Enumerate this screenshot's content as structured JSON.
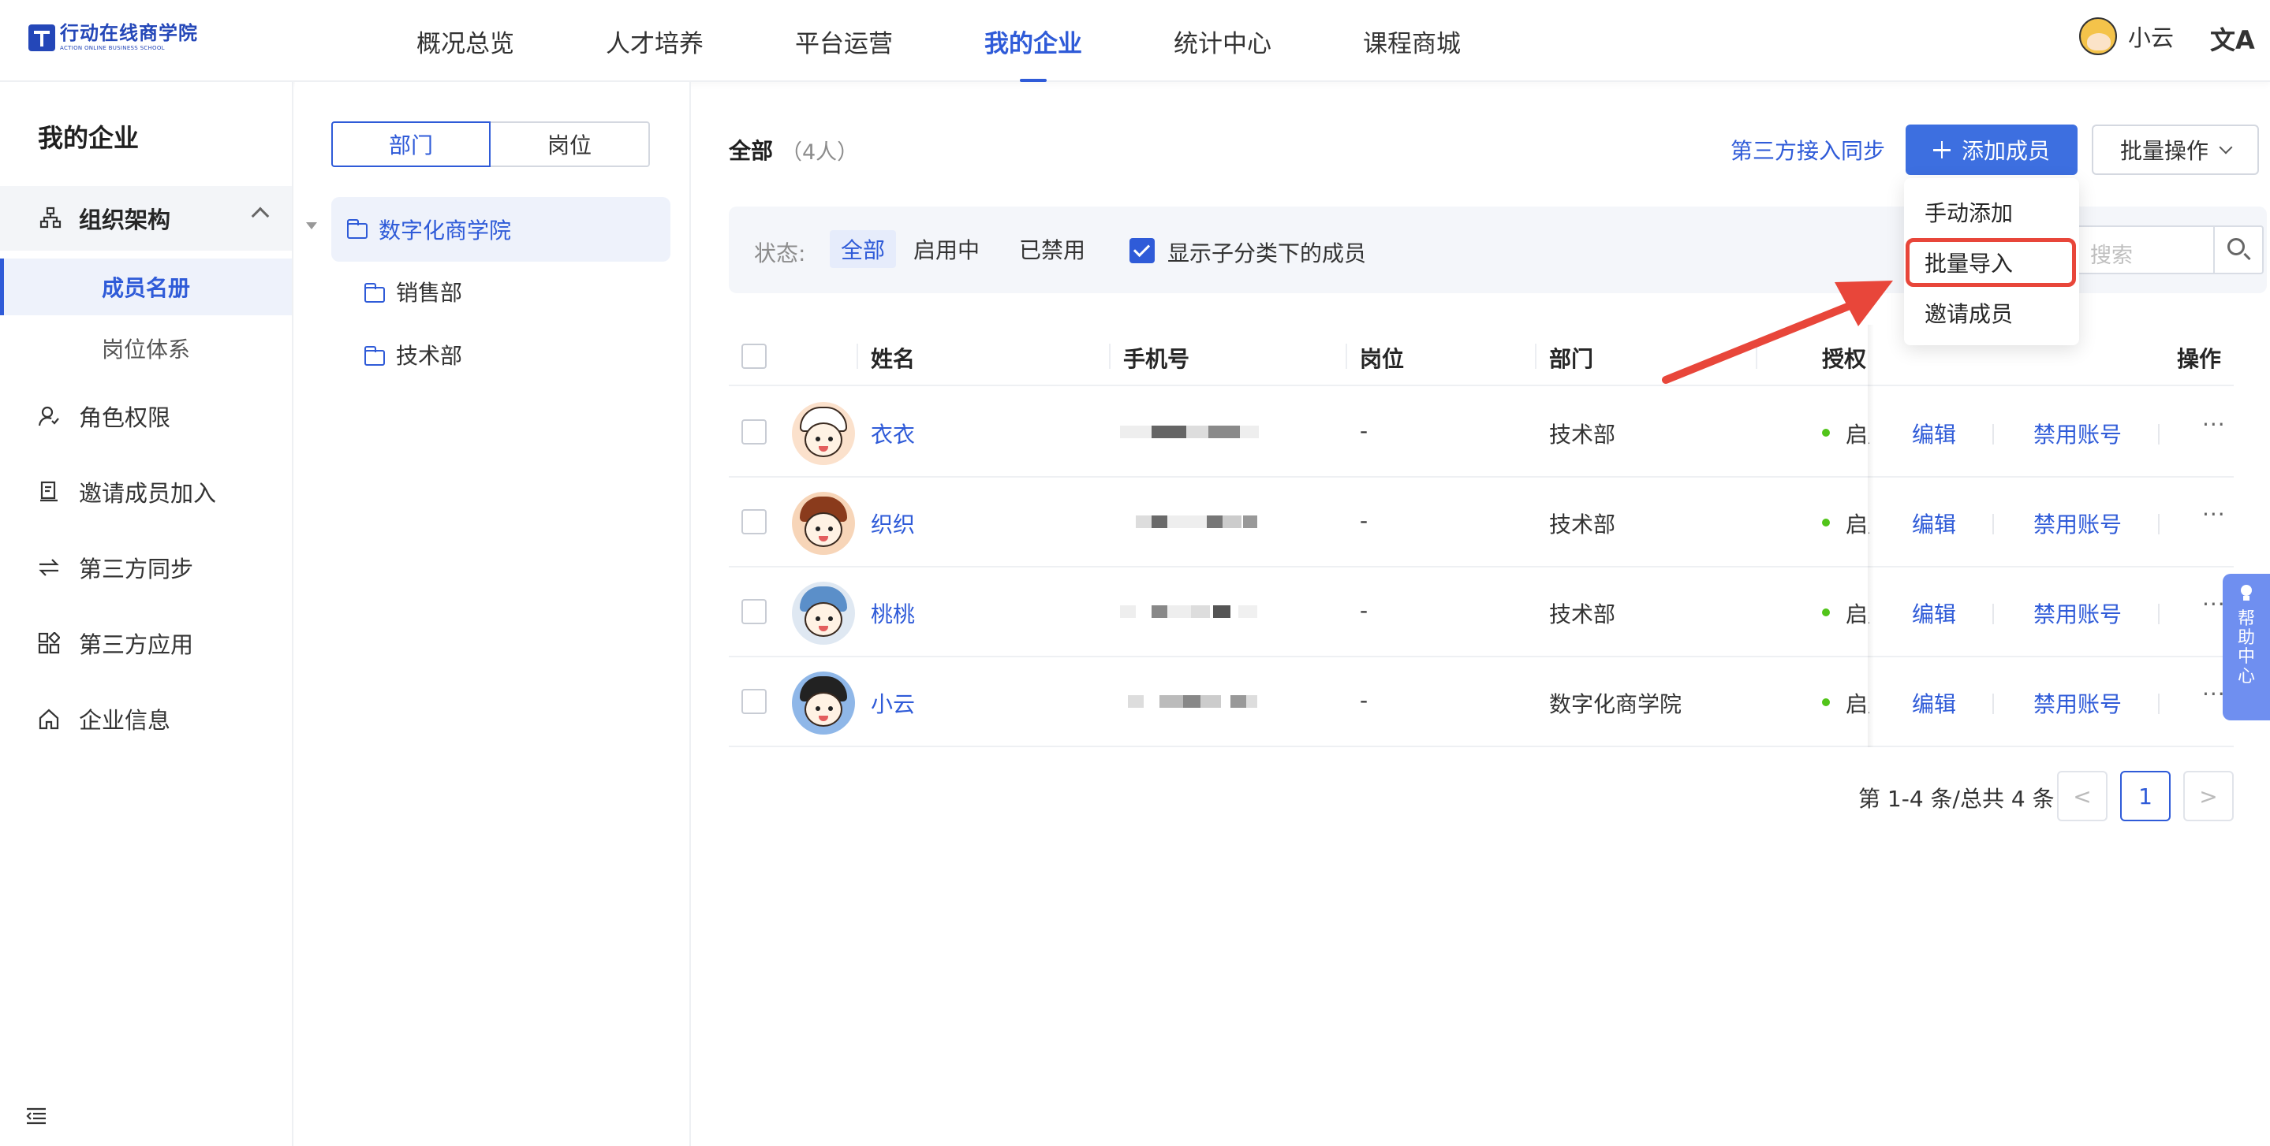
{
  "app": {
    "logo_cn": "行动在线商学院",
    "logo_en": "ACTION ONLINE BUSINESS SCHOOL"
  },
  "nav": {
    "items": [
      {
        "label": "概况总览"
      },
      {
        "label": "人才培养"
      },
      {
        "label": "平台运营"
      },
      {
        "label": "我的企业",
        "active": true
      },
      {
        "label": "统计中心"
      },
      {
        "label": "课程商城"
      }
    ],
    "user_name": "小云",
    "lang_icon": "文A"
  },
  "sidebar": {
    "title": "我的企业",
    "group": {
      "label": "组织架构",
      "icon": "org-chart-icon",
      "expanded": true
    },
    "sub_items": [
      {
        "label": "成员名册",
        "active": true
      },
      {
        "label": "岗位体系"
      }
    ],
    "items": [
      {
        "label": "角色权限",
        "icon": "role-icon"
      },
      {
        "label": "邀请成员加入",
        "icon": "invite-icon"
      },
      {
        "label": "第三方同步",
        "icon": "sync-icon"
      },
      {
        "label": "第三方应用",
        "icon": "apps-icon"
      },
      {
        "label": "企业信息",
        "icon": "home-icon"
      }
    ]
  },
  "tree": {
    "tabs": [
      {
        "label": "部门",
        "active": true
      },
      {
        "label": "岗位"
      }
    ],
    "root": "数字化商学院",
    "children": [
      "销售部",
      "技术部"
    ]
  },
  "main": {
    "title": "全部",
    "count": "（4人）",
    "third_party_sync": "第三方接入同步",
    "add_member": "添加成员",
    "batch_ops": "批量操作",
    "filter": {
      "label": "状态:",
      "options": [
        {
          "label": "全部",
          "active": true
        },
        {
          "label": "启用中"
        },
        {
          "label": "已禁用"
        }
      ],
      "show_sub_label": "显示子分类下的成员",
      "show_sub_checked": true,
      "search_placeholder": "搜索"
    },
    "table": {
      "columns": [
        "姓名",
        "手机号",
        "岗位",
        "部门",
        "授权",
        "操作"
      ],
      "rows": [
        {
          "name": "衣衣",
          "position": "-",
          "department": "技术部",
          "status": "启用中",
          "edit": "编辑",
          "disable": "禁用账号",
          "more": "···"
        },
        {
          "name": "织织",
          "position": "-",
          "department": "技术部",
          "status": "启用中",
          "edit": "编辑",
          "disable": "禁用账号",
          "more": "···"
        },
        {
          "name": "桃桃",
          "position": "-",
          "department": "技术部",
          "status": "启用中",
          "edit": "编辑",
          "disable": "禁用账号",
          "more": "···"
        },
        {
          "name": "小云",
          "position": "-",
          "department": "数字化商学院",
          "status": "启用中",
          "edit": "编辑",
          "disable": "禁用账号",
          "more": "···"
        }
      ]
    },
    "pagination": {
      "total": "第 1-4 条/总共 4 条",
      "current": "1",
      "prev": "<",
      "next": ">"
    }
  },
  "dropdown": {
    "items": [
      "手动添加",
      "批量导入",
      "邀请成员"
    ],
    "highlighted": "批量导入"
  },
  "help": {
    "label": "帮助中心"
  },
  "colors": {
    "primary": "#2f5bd8",
    "highlight": "#e8463a",
    "success": "#52c41a"
  }
}
